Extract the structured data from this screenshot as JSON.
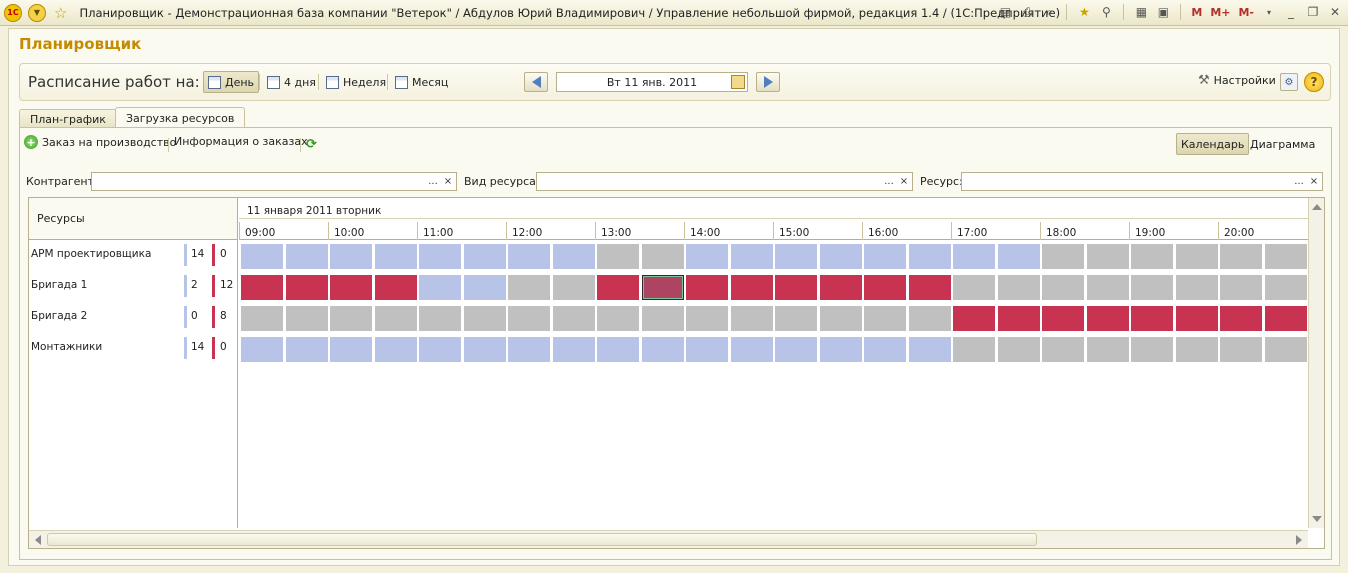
{
  "window": {
    "title": "Планировщик - Демонстрационная база компании \"Ветерок\" / Абдулов Юрий Владимирович / Управление небольшой фирмой, редакция 1.4 / (1С:Предприятие)",
    "logo_text": "1С",
    "m_buttons": [
      "M",
      "M+",
      "M-"
    ]
  },
  "form": {
    "title": "Планировщик"
  },
  "schedule": {
    "label": "Расписание работ на:",
    "views": [
      {
        "label": "День",
        "active": true
      },
      {
        "label": "4 дня",
        "active": false
      },
      {
        "label": "Неделя",
        "active": false
      },
      {
        "label": "Месяц",
        "active": false
      }
    ],
    "date": "Вт 11 янв. 2011",
    "settings_label": "Настройки"
  },
  "tabs": [
    {
      "label": "План-график",
      "active": false
    },
    {
      "label": "Загрузка ресурсов",
      "active": true
    }
  ],
  "commands": {
    "order_label": "Заказ на производство",
    "info_label": "Информация о заказах",
    "calendar_label": "Календарь",
    "diagram_label": "Диаграмма"
  },
  "filters": {
    "counterparty_label": "Контрагент:",
    "resource_type_label": "Вид ресурса:",
    "resource_label": "Ресурс:",
    "button_select": "...",
    "button_clear": "×"
  },
  "grid": {
    "resources_header": "Ресурсы",
    "date_header": "11 января 2011 вторник",
    "hours": [
      "09:00",
      "10:00",
      "11:00",
      "12:00",
      "13:00",
      "14:00",
      "15:00",
      "16:00",
      "17:00",
      "18:00",
      "19:00",
      "20:00"
    ],
    "rows": [
      {
        "name": "АРМ проектировщика",
        "free": "14",
        "busy": "0",
        "cells": [
          "f",
          "f",
          "f",
          "f",
          "f",
          "f",
          "f",
          "f",
          "o",
          "o",
          "f",
          "f",
          "f",
          "f",
          "f",
          "f",
          "f",
          "f",
          "o",
          "o",
          "o",
          "o",
          "o",
          "o",
          "o"
        ]
      },
      {
        "name": "Бригада 1",
        "free": "2",
        "busy": "12",
        "cells": [
          "b",
          "b",
          "b",
          "b",
          "f",
          "f",
          "o",
          "o",
          "b",
          "s",
          "b",
          "b",
          "b",
          "b",
          "b",
          "b",
          "o",
          "o",
          "o",
          "o",
          "o",
          "o",
          "o",
          "o",
          "o"
        ]
      },
      {
        "name": "Бригада 2",
        "free": "0",
        "busy": "8",
        "cells": [
          "o",
          "o",
          "o",
          "o",
          "o",
          "o",
          "o",
          "o",
          "o",
          "o",
          "o",
          "o",
          "o",
          "o",
          "o",
          "o",
          "b",
          "b",
          "b",
          "b",
          "b",
          "b",
          "b",
          "b",
          "b"
        ]
      },
      {
        "name": "Монтажники",
        "free": "14",
        "busy": "0",
        "cells": [
          "f",
          "f",
          "f",
          "f",
          "f",
          "f",
          "f",
          "f",
          "f",
          "f",
          "f",
          "f",
          "f",
          "f",
          "f",
          "f",
          "o",
          "o",
          "o",
          "o",
          "o",
          "o",
          "o",
          "o",
          "o"
        ]
      }
    ]
  },
  "colors": {
    "free": "#b7c4e8",
    "busy": "#c93352",
    "off": "#c0c0c0",
    "accent_title": "#c48b00"
  }
}
